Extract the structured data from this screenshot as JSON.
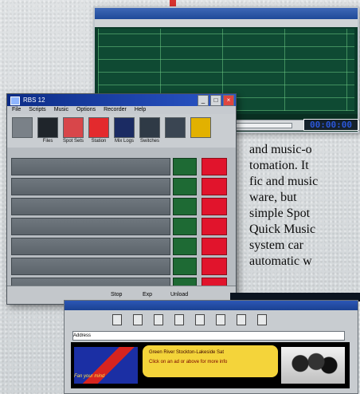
{
  "main_window": {
    "title": "RBS 12",
    "menu": [
      "File",
      "Scripts",
      "Music",
      "Options",
      "Recorder",
      "Help"
    ],
    "toolbar": [
      {
        "label": "",
        "icon": "microphone-icon"
      },
      {
        "label": "Files",
        "icon": "folder-icon"
      },
      {
        "label": "Spot Sets",
        "icon": "spot-icon"
      },
      {
        "label": "Station",
        "icon": "station-icon"
      },
      {
        "label": "Mix Logs",
        "icon": "log-icon"
      },
      {
        "label": "Switches",
        "icon": "switch-icon"
      },
      {
        "label": "",
        "icon": "print-icon"
      },
      {
        "label": "",
        "icon": "bell-icon"
      }
    ],
    "bottom_checks": [
      "Stop",
      "Exp",
      "Unload"
    ]
  },
  "timecode": "00:00:00",
  "article_lines": [
    "and music-o",
    "tomation. It",
    "fic and music",
    "ware, but",
    "simple Spot",
    "Quick Music",
    "system car",
    "automatic w"
  ],
  "browser": {
    "address_label": "Address",
    "banner_line_1": "Green River   Stockton-Lakeside Sat",
    "banner_line_2": "Click on an ad or above for more info",
    "logo_text": "Fan your mind"
  },
  "colors": {
    "accent_green": "#1e6a34",
    "accent_red": "#e1142c",
    "timecode_blue": "#2a56d8"
  }
}
